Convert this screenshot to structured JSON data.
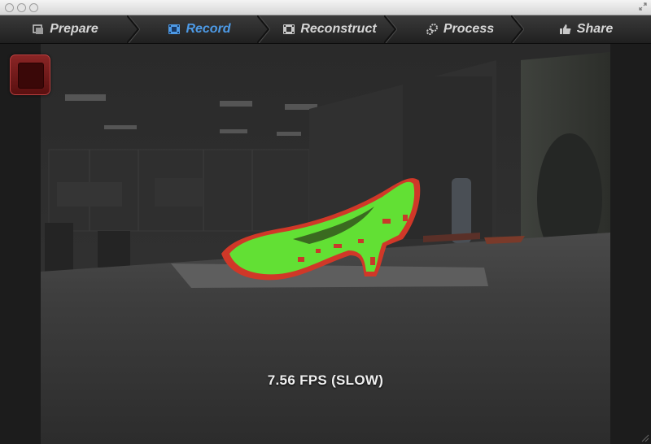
{
  "toolbar": {
    "steps": [
      {
        "label": "Prepare",
        "icon": "prepare-icon",
        "active": false
      },
      {
        "label": "Record",
        "icon": "film-icon",
        "active": true
      },
      {
        "label": "Reconstruct",
        "icon": "clapper-icon",
        "active": false
      },
      {
        "label": "Process",
        "icon": "gears-icon",
        "active": false
      },
      {
        "label": "Share",
        "icon": "thumbs-up-icon",
        "active": false
      }
    ]
  },
  "status": {
    "fps_text": "7.56 FPS (SLOW)"
  },
  "colors": {
    "active_step": "#4d9ae6",
    "inactive_step": "#d6d6d6",
    "scan_good": "#6aea3c",
    "scan_bad": "#d83a2a",
    "stop_button": "#7a1c1c"
  }
}
